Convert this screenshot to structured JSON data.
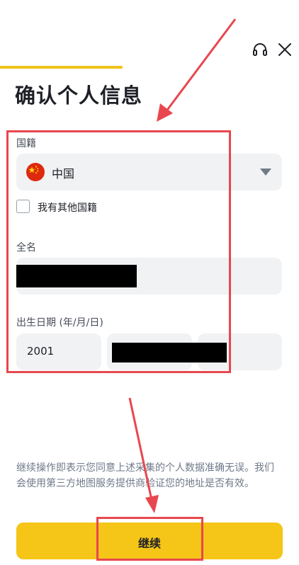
{
  "header": {
    "progress_fraction": 0.41,
    "support_icon": "headset-icon",
    "close_icon": "close-icon"
  },
  "page": {
    "title": "确认个人信息"
  },
  "nationality": {
    "label": "国籍",
    "selected_value": "中国",
    "flag_icon": "china-flag-icon",
    "caret_icon": "caret-down-icon",
    "other_nationality_label": "我有其他国籍",
    "other_nationality_checked": false
  },
  "full_name": {
    "label": "全名",
    "value_redacted": true
  },
  "dob": {
    "label": "出生日期 (年/月/日)",
    "year": "2001",
    "month_day_redacted": true
  },
  "footer": {
    "consent_text": "继续操作即表示您同意上述采集的个人数据准确无误。我们会使用第三方地图服务提供商验证您的地址是否有效。",
    "continue_label": "继续"
  },
  "colors": {
    "accent": "#f5c518",
    "progress": "#f0c21a",
    "annotation": "#e8474f",
    "field_bg": "#f1f2f4"
  }
}
